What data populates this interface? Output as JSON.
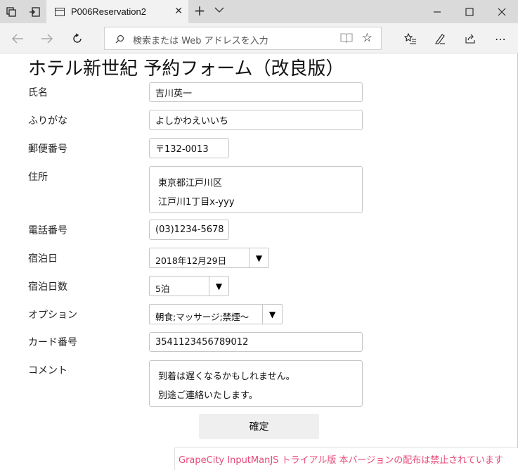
{
  "browser": {
    "tab_title": "P006Reservation2",
    "address_placeholder": "検索または Web アドレスを入力"
  },
  "page": {
    "title": "ホテル新世紀 予約フォーム（改良版）"
  },
  "form": {
    "name": {
      "label": "氏名",
      "value": "吉川英一"
    },
    "furigana": {
      "label": "ふりがな",
      "value": "よしかわえいいち"
    },
    "postal": {
      "label": "郵便番号",
      "value": "〒132-0013"
    },
    "address": {
      "label": "住所",
      "line1": "東京都江戸川区",
      "line2": "江戸川1丁目x-yyy"
    },
    "phone": {
      "label": "電話番号",
      "value": "(03)1234-5678"
    },
    "checkin": {
      "label": "宿泊日",
      "value": "2018年12月29日"
    },
    "nights": {
      "label": "宿泊日数",
      "value": "5泊"
    },
    "options": {
      "label": "オプション",
      "value": "朝食;マッサージ;禁煙～"
    },
    "card": {
      "label": "カード番号",
      "value": "3541123456789012"
    },
    "comment": {
      "label": "コメント",
      "line1": "到着は遅くなるかもしれません。",
      "line2": "別途ご連絡いたします。"
    },
    "submit_label": "確定"
  },
  "trial_notice": "GrapeCity InputManJS トライアル版 本バージョンの配布は禁止されています",
  "icons": {
    "dropdown": "▼"
  }
}
